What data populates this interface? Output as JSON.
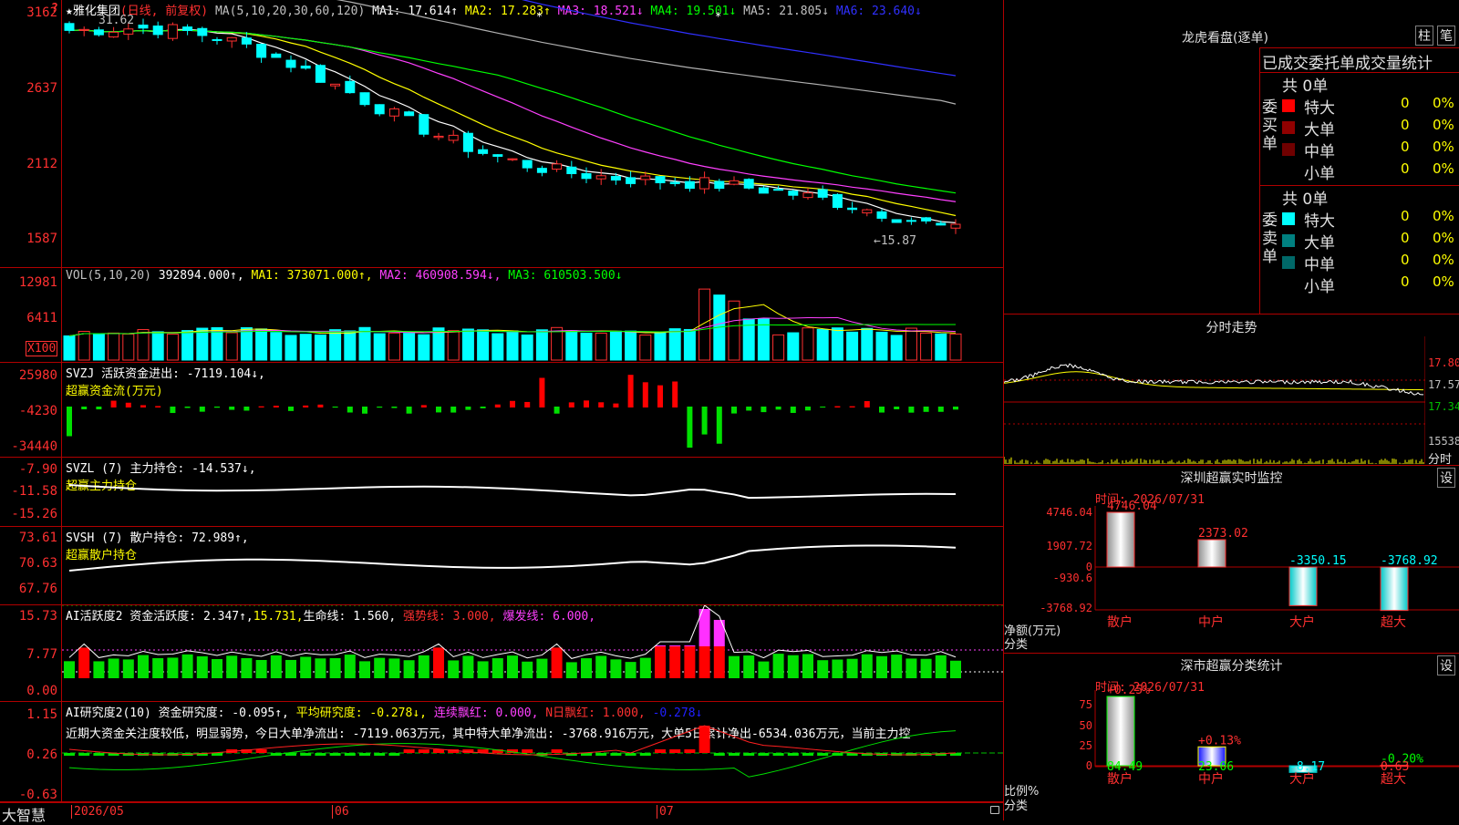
{
  "stock": {
    "name": "★雅化集团",
    "mode": "(日线, 前复权)",
    "ma_label": "MA(5,10,20,30,60,120)",
    "ma": [
      {
        "label": "MA1:",
        "val": "17.614↑",
        "color": "#ffffff"
      },
      {
        "label": "MA2:",
        "val": "17.283↑",
        "color": "#ffff00"
      },
      {
        "label": "MA3:",
        "val": "18.521↓",
        "color": "#ff40ff"
      },
      {
        "label": "MA4:",
        "val": "19.501↓",
        "color": "#00ff00"
      },
      {
        "label": "MA5:",
        "val": "21.805↓",
        "color": "#c0c0c0"
      },
      {
        "label": "MA6:",
        "val": "23.640↓",
        "color": "#3030ff"
      }
    ],
    "high_label": "31.62",
    "low_label": "←15.87",
    "y_labels": [
      "3162",
      "2637",
      "2112",
      "1587"
    ]
  },
  "vol": {
    "header": "VOL(5,10,20)",
    "value": "392894.000↑,",
    "ma1": "MA1: 373071.000↑,",
    "ma2": "MA2: 460908.594↓,",
    "ma3": "MA3: 610503.500↓",
    "y_labels": [
      "12981",
      "6411"
    ],
    "unit": "X100"
  },
  "svzj": {
    "header": "SVZJ  活跃资金进出: -7119.104↓,",
    "sub": "超赢资金流(万元)",
    "y_labels": [
      "25980",
      "-4230",
      "-34440"
    ]
  },
  "svzl": {
    "header": "SVZL (7) 主力持仓: -14.537↓,",
    "sub": "超赢主力持仓",
    "y_labels": [
      "-7.90",
      "-11.58",
      "-15.26"
    ]
  },
  "svsh": {
    "header": "SVSH (7) 散户持仓: 72.989↑,",
    "sub": "超赢散户持仓",
    "y_labels": [
      "73.61",
      "70.63",
      "67.76"
    ]
  },
  "ai1": {
    "header": "AI活跃度2 资金活跃度: 2.347↑,",
    "v2": "15.731,",
    "v3": "生命线: 1.560,",
    "v4": "强势线: 3.000,",
    "v5": "爆发线: 6.000,",
    "y_labels": [
      "15.73",
      "7.77",
      "0.00"
    ]
  },
  "ai2": {
    "header": "AI研究度2(10) 资金研究度: -0.095↑,",
    "v2": "平均研究度: -0.278↓,",
    "v3": "连续飘红: 0.000,",
    "v4": "N日飘红: 1.000,",
    "v5": "-0.278↓",
    "text": "近期大资金关注度较低，明显弱势，今日大单净流出: -7119.063万元，其中特大单净流出: -3768.916万元，大单5日累计净出-6534.036万元，当前主力控",
    "y_labels": [
      "1.15",
      "0.26",
      "-0.63"
    ]
  },
  "bottom": {
    "brand": "大智慧",
    "dates": [
      "2026/05",
      "06",
      "07"
    ]
  },
  "longhu": {
    "title": "龙虎看盘(逐单)",
    "btn1": "柱",
    "btn2": "笔",
    "subtitle": "已成交委托单成交量统计",
    "buy_label": "委买单",
    "sell_label": "委卖单",
    "buy_total": "共 0单",
    "sell_total": "共 0单",
    "buy_rows": [
      {
        "name": "特大",
        "v": "0",
        "p": "0%",
        "color": "#ff0000"
      },
      {
        "name": "大单",
        "v": "0",
        "p": "0%",
        "color": "#900000"
      },
      {
        "name": "中单",
        "v": "0",
        "p": "0%",
        "color": "#700000"
      },
      {
        "name": "小单",
        "v": "0",
        "p": "0%",
        "color": "#000000"
      }
    ],
    "sell_rows": [
      {
        "name": "特大",
        "v": "0",
        "p": "0%",
        "color": "#00ffff"
      },
      {
        "name": "大单",
        "v": "0",
        "p": "0%",
        "color": "#008080"
      },
      {
        "name": "中单",
        "v": "0",
        "p": "0%",
        "color": "#006868"
      },
      {
        "name": "小单",
        "v": "0",
        "p": "0%",
        "color": "#000000"
      }
    ]
  },
  "intraday": {
    "title": "分时走势",
    "labels": [
      "17.80",
      "17.57",
      "17.34",
      "15538"
    ],
    "footer": "分时"
  },
  "sz_monitor": {
    "title": "深圳超赢实时监控",
    "btn": "设",
    "time": "时间: 2026/07/31",
    "y_labels": [
      "4746.04",
      "1907.72",
      "0",
      "-930.6",
      "-3768.92"
    ],
    "unit": "净额(万元)",
    "cat": "分类",
    "bars": [
      {
        "name": "散户",
        "value": 4746.04,
        "label": "4746.04"
      },
      {
        "name": "中户",
        "value": 2373.02,
        "label": "2373.02"
      },
      {
        "name": "大户",
        "value": -3350.15,
        "label": "-3350.15"
      },
      {
        "name": "超大",
        "value": -3768.92,
        "label": "-3768.92"
      }
    ]
  },
  "sz_cat": {
    "title": "深市超赢分类统计",
    "btn": "设",
    "time": "时间: 2026/07/31",
    "y_labels": [
      "75",
      "50",
      "25",
      "0"
    ],
    "unit": "比例%",
    "cat": "分类",
    "bars": [
      {
        "name": "散户",
        "value": 84.49,
        "label": "84.49",
        "top": "+0.25%"
      },
      {
        "name": "中户",
        "value": 23.06,
        "label": "23.06",
        "top": "+0.13%"
      },
      {
        "name": "大户",
        "value": -8.17,
        "label": "-8.17",
        "top": ""
      },
      {
        "name": "超大",
        "value": 0.63,
        "label": "0.63",
        "top": "-0.20%"
      }
    ]
  }
}
